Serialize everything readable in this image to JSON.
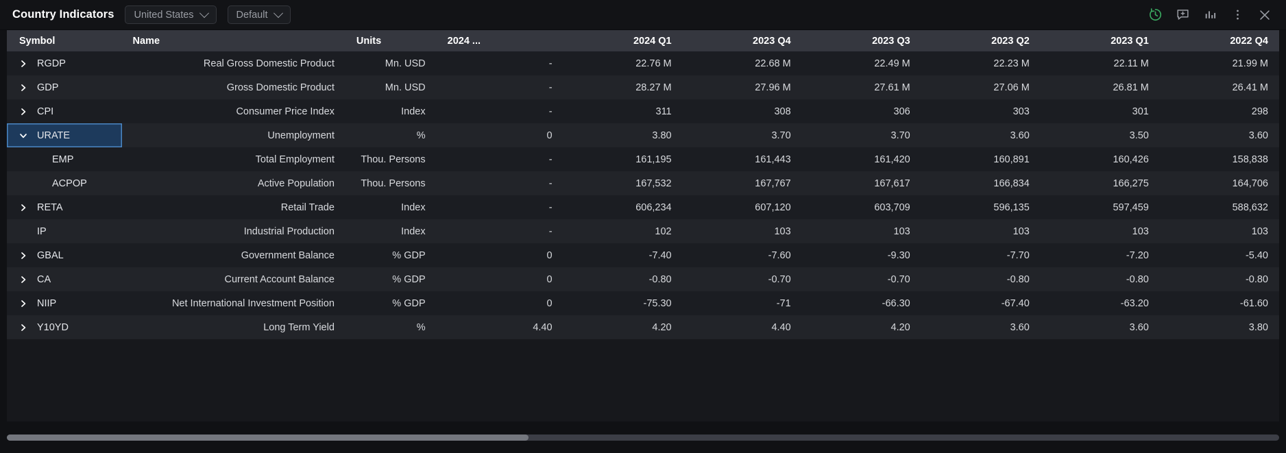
{
  "titlebar": {
    "title": "Country Indicators",
    "country_selector": "United States",
    "preset_selector": "Default",
    "icons": [
      {
        "name": "history-icon",
        "color": "#3aa860"
      },
      {
        "name": "comment-add-icon",
        "color": "#9a9da4"
      },
      {
        "name": "bar-chart-icon",
        "color": "#9a9da4"
      },
      {
        "name": "more-vertical-icon",
        "color": "#9a9da4"
      },
      {
        "name": "close-icon",
        "color": "#9a9da4"
      }
    ]
  },
  "table": {
    "columns": [
      "Symbol",
      "Name",
      "Units",
      "2024 ...",
      "2024 Q1",
      "2023 Q4",
      "2023 Q3",
      "2023 Q2",
      "2023 Q1",
      "2022 Q4"
    ],
    "rows": [
      {
        "expandable": true,
        "expanded": false,
        "child": false,
        "selected": false,
        "symbol": "RGDP",
        "name": "Real Gross Domestic Product",
        "units": "Mn. USD",
        "partial": "-",
        "values": [
          "22.76 M",
          "22.68 M",
          "22.49 M",
          "22.23 M",
          "22.11 M",
          "21.99 M"
        ]
      },
      {
        "expandable": true,
        "expanded": false,
        "child": false,
        "selected": false,
        "symbol": "GDP",
        "name": "Gross Domestic Product",
        "units": "Mn. USD",
        "partial": "-",
        "values": [
          "28.27 M",
          "27.96 M",
          "27.61 M",
          "27.06 M",
          "26.81 M",
          "26.41 M"
        ]
      },
      {
        "expandable": true,
        "expanded": false,
        "child": false,
        "selected": false,
        "symbol": "CPI",
        "name": "Consumer Price Index",
        "units": "Index",
        "partial": "-",
        "values": [
          "311",
          "308",
          "306",
          "303",
          "301",
          "298"
        ]
      },
      {
        "expandable": true,
        "expanded": true,
        "child": false,
        "selected": true,
        "symbol": "URATE",
        "name": "Unemployment",
        "units": "%",
        "partial": "0",
        "values": [
          "3.80",
          "3.70",
          "3.70",
          "3.60",
          "3.50",
          "3.60"
        ]
      },
      {
        "expandable": false,
        "expanded": false,
        "child": true,
        "selected": false,
        "symbol": "EMP",
        "name": "Total Employment",
        "units": "Thou. Persons",
        "partial": "-",
        "values": [
          "161,195",
          "161,443",
          "161,420",
          "160,891",
          "160,426",
          "158,838"
        ]
      },
      {
        "expandable": false,
        "expanded": false,
        "child": true,
        "selected": false,
        "symbol": "ACPOP",
        "name": "Active Population",
        "units": "Thou. Persons",
        "partial": "-",
        "values": [
          "167,532",
          "167,767",
          "167,617",
          "166,834",
          "166,275",
          "164,706"
        ]
      },
      {
        "expandable": true,
        "expanded": false,
        "child": false,
        "selected": false,
        "symbol": "RETA",
        "name": "Retail Trade",
        "units": "Index",
        "partial": "-",
        "values": [
          "606,234",
          "607,120",
          "603,709",
          "596,135",
          "597,459",
          "588,632"
        ]
      },
      {
        "expandable": false,
        "expanded": false,
        "child": false,
        "selected": false,
        "symbol": "IP",
        "name": "Industrial Production",
        "units": "Index",
        "partial": "-",
        "values": [
          "102",
          "103",
          "103",
          "103",
          "103",
          "103"
        ]
      },
      {
        "expandable": true,
        "expanded": false,
        "child": false,
        "selected": false,
        "symbol": "GBAL",
        "name": "Government Balance",
        "units": "% GDP",
        "partial": "0",
        "values": [
          "-7.40",
          "-7.60",
          "-9.30",
          "-7.70",
          "-7.20",
          "-5.40"
        ]
      },
      {
        "expandable": true,
        "expanded": false,
        "child": false,
        "selected": false,
        "symbol": "CA",
        "name": "Current Account Balance",
        "units": "% GDP",
        "partial": "0",
        "values": [
          "-0.80",
          "-0.70",
          "-0.70",
          "-0.80",
          "-0.80",
          "-0.80"
        ]
      },
      {
        "expandable": true,
        "expanded": false,
        "child": false,
        "selected": false,
        "symbol": "NIIP",
        "name": "Net International Investment Position",
        "units": "% GDP",
        "partial": "0",
        "values": [
          "-75.30",
          "-71",
          "-66.30",
          "-67.40",
          "-63.20",
          "-61.60"
        ]
      },
      {
        "expandable": true,
        "expanded": false,
        "child": false,
        "selected": false,
        "symbol": "Y10YD",
        "name": "Long Term Yield",
        "units": "%",
        "partial": "4.40",
        "values": [
          "4.20",
          "4.40",
          "4.20",
          "3.60",
          "3.60",
          "3.80"
        ]
      }
    ]
  },
  "scrollbar": {
    "thumb_percent": 41
  },
  "colors": {
    "accent_green": "#3aa860",
    "selection_blue": "#1d3a5c",
    "selection_border": "#4b87c4",
    "header_bg": "#35373f"
  }
}
